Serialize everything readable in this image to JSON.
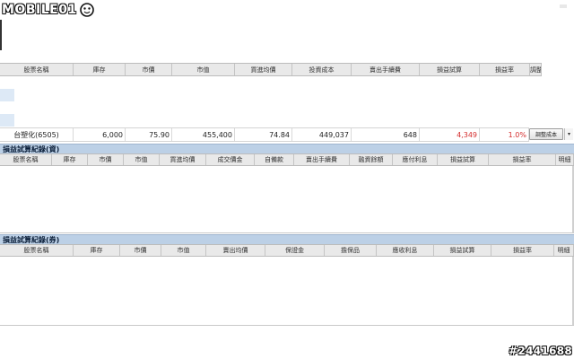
{
  "logo": {
    "text": "MOBILE01"
  },
  "watermark": {
    "id": "#2441688"
  },
  "holdings": {
    "columns": [
      "股票名稱",
      "庫存",
      "市價",
      "市值",
      "買進均價",
      "投資成本",
      "賣出手續費",
      "損益試算",
      "損益率",
      "調整"
    ],
    "row": {
      "name": "台塑化(6505)",
      "qty": "6,000",
      "price": "75.90",
      "value": "455,400",
      "avg_price": "74.84",
      "cost": "449,037",
      "fee": "648",
      "pnl": "4,349",
      "rate": "1.0%"
    },
    "adjust_button": "調整成本",
    "dropdown_glyph": "▾"
  },
  "margin_section": {
    "title": "損益試算紀錄(資)",
    "columns": [
      "股票名稱",
      "庫存",
      "市價",
      "市值",
      "買進均價",
      "成交價金",
      "自備款",
      "賣出手續費",
      "融資餘額",
      "應付利息",
      "損益試算",
      "損益率",
      "明細"
    ]
  },
  "short_section": {
    "title": "損益試算紀錄(券)",
    "columns": [
      "股票名稱",
      "庫存",
      "市價",
      "市值",
      "賣出均價",
      "保證金",
      "擔保品",
      "應收利息",
      "損益試算",
      "損益率",
      "明細"
    ]
  },
  "colors": {
    "loss_red": "#d42c2c",
    "section_bar": "#bcd0e6"
  }
}
